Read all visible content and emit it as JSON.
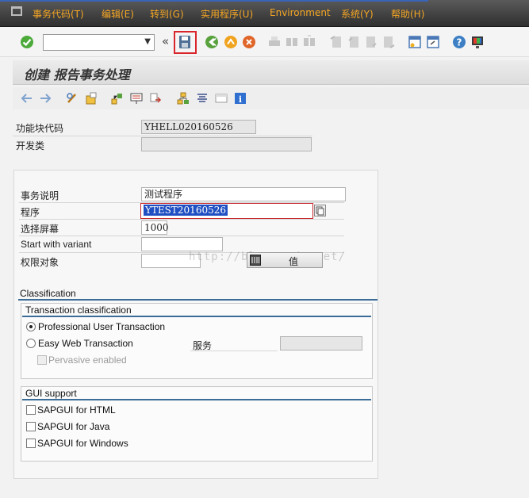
{
  "menu": {
    "items": [
      "事务代码(T)",
      "编辑(E)",
      "转到(G)",
      "实用程序(U)",
      "Environment",
      "系统(Y)",
      "帮助(H)"
    ]
  },
  "toolbar": {
    "command_field_value": "",
    "icons": [
      "enter-check-icon",
      "collapse-icon",
      "save-icon",
      "back-icon",
      "exit-icon",
      "cancel-icon",
      "print-icon",
      "find-icon",
      "find-next-icon",
      "first-page-icon",
      "prev-page-icon",
      "next-page-icon",
      "last-page-icon",
      "create-session-icon",
      "shortcut-icon",
      "help-icon",
      "customize-layout-icon"
    ]
  },
  "title": "创建 报告事务处理",
  "header": {
    "package_label": "功能块代码",
    "package_value": "YHELL020160526",
    "dev_class_label": "开发类",
    "dev_class_value": ""
  },
  "form": {
    "desc_label": "事务说明",
    "desc_value": "测试程序",
    "program_label": "程序",
    "program_value": "YTEST20160526",
    "screen_label": "选择屏幕",
    "screen_value": "1000",
    "variant_label": "Start with variant",
    "variant_value": "",
    "auth_label": "权限对象",
    "auth_value": "",
    "values_button": "值"
  },
  "classification": {
    "title": "Classification",
    "transaction_title": "Transaction classification",
    "professional": "Professional User Transaction",
    "easy_web": "Easy Web Transaction",
    "service_label": "服务",
    "pervasive": "Pervasive enabled",
    "selected": "professional"
  },
  "gui_support": {
    "title": "GUI support",
    "html": "SAPGUI for HTML",
    "java": "SAPGUI for Java",
    "windows": "SAPGUI for Windows"
  },
  "watermark": "http://blog.csdn.net/",
  "colors": {
    "menu_text": "#f5a623",
    "selection": "#1f4fc2",
    "highlight_box": "#d9262c",
    "group_rule": "#3b6d98"
  }
}
